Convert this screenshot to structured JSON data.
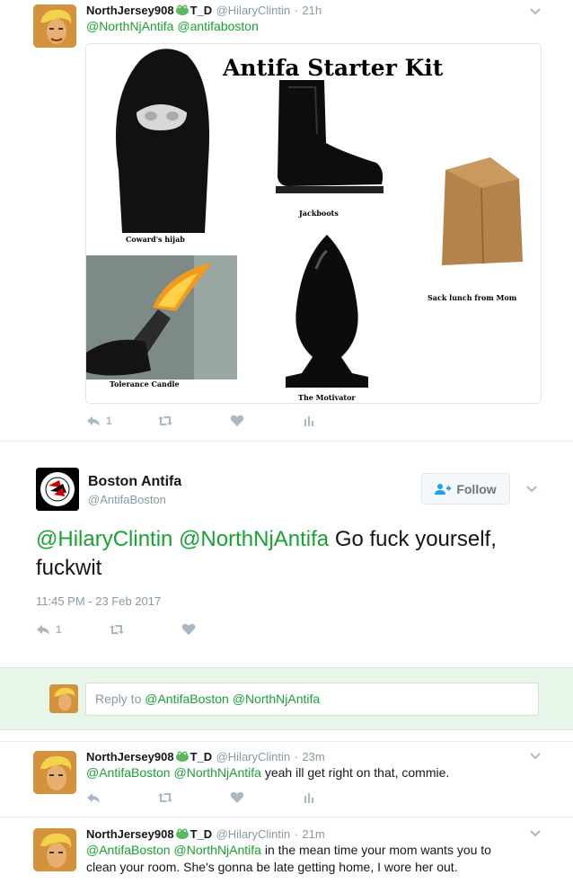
{
  "tweet1": {
    "name": "NorthJersey908",
    "name_suffix": "T_D",
    "handle": "@HilaryClintin",
    "time": "21h",
    "mention1": "@NorthNjAntifa",
    "mention2": "@antifaboston",
    "reply_count": "1",
    "image": {
      "title": "Antifa Starter Kit",
      "labels": {
        "hijab": "Coward's hijab",
        "jackboots": "Jackboots",
        "sack": "Sack lunch from Mom",
        "candle": "Tolerance Candle",
        "motivator": "The Motivator"
      }
    }
  },
  "main_tweet": {
    "name": "Boston Antifa",
    "handle": "@AntifaBoston",
    "follow_label": "Follow",
    "mention1": "@HilaryClintin",
    "mention2": "@NorthNjAntifa",
    "text": " Go fuck yourself, fuckwit",
    "timestamp": "11:45 PM - 23 Feb 2017",
    "reply_count": "1"
  },
  "reply_box": {
    "prefix": "Reply to ",
    "mentions": "@AntifaBoston @NorthNjAntifa"
  },
  "tweet2": {
    "name": "NorthJersey908",
    "name_suffix": "T_D",
    "handle": "@HilaryClintin",
    "time": "23m",
    "mention1": "@AntifaBoston",
    "mention2": "@NorthNjAntifa",
    "text": " yeah ill get right on that, commie."
  },
  "tweet3": {
    "name": "NorthJersey908",
    "name_suffix": "T_D",
    "handle": "@HilaryClintin",
    "time": "21m",
    "mention1": "@AntifaBoston",
    "mention2": "@NorthNjAntifa",
    "text_line1": " in the mean time your mom wants you to",
    "text_line2": "clean your room. She's gonna be late getting home, I wore her out."
  },
  "colors": {
    "link": "#19a234",
    "follow_icon": "#1da1f2",
    "muted": "#8899a6",
    "reply_bg": "#e8f5e9"
  },
  "icons": [
    "reply-icon",
    "retweet-icon",
    "like-icon",
    "analytics-icon",
    "chevron-down-icon",
    "frog-icon",
    "add-user-icon"
  ]
}
